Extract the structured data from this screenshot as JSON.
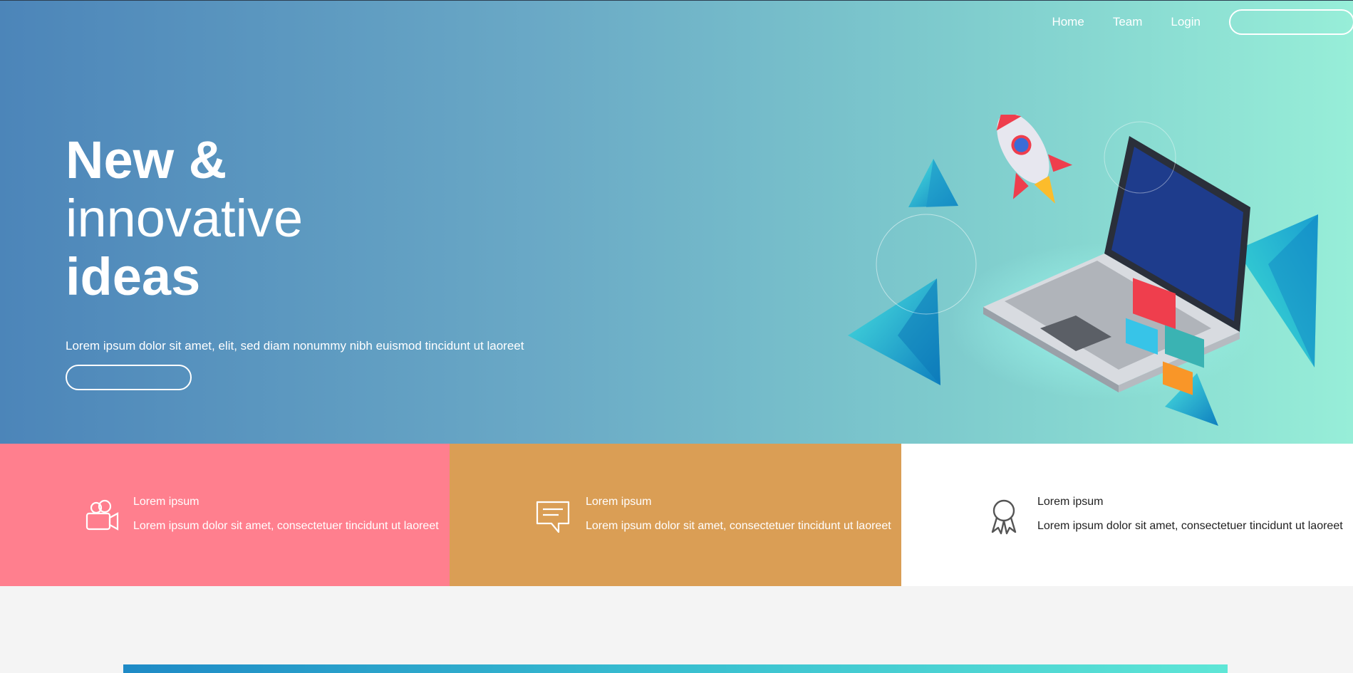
{
  "nav": {
    "items": [
      "Home",
      "Team",
      "Login"
    ],
    "button_label": ""
  },
  "hero": {
    "headline_line1": "New &",
    "headline_line2": "innovative",
    "headline_line3": "ideas",
    "text": "Lorem ipsum dolor sit amet, elit, sed diam nonummy nibh euismod tincidunt ut laoreet",
    "button_label": "",
    "illustration": "laptop-rocket-illustration"
  },
  "features": [
    {
      "icon": "video-camera-icon",
      "title": "Lorem ipsum",
      "text": "Lorem ipsum dolor sit amet, consectetuer tincidunt ut laoreet",
      "color": "#ff7f8e"
    },
    {
      "icon": "chat-bubble-icon",
      "title": "Lorem ipsum",
      "text": "Lorem ipsum dolor sit amet, consectetuer tincidunt ut laoreet",
      "color": "#da9e55"
    },
    {
      "icon": "award-ribbon-icon",
      "title": "Lorem ipsum",
      "text": "Lorem ipsum dolor sit amet, consectetuer tincidunt ut laoreet",
      "color": "#ffffff"
    }
  ],
  "colors": {
    "hero_gradient_start": "#4c85b9",
    "hero_gradient_end": "#97eed8",
    "page_background": "#f4f4f4"
  }
}
